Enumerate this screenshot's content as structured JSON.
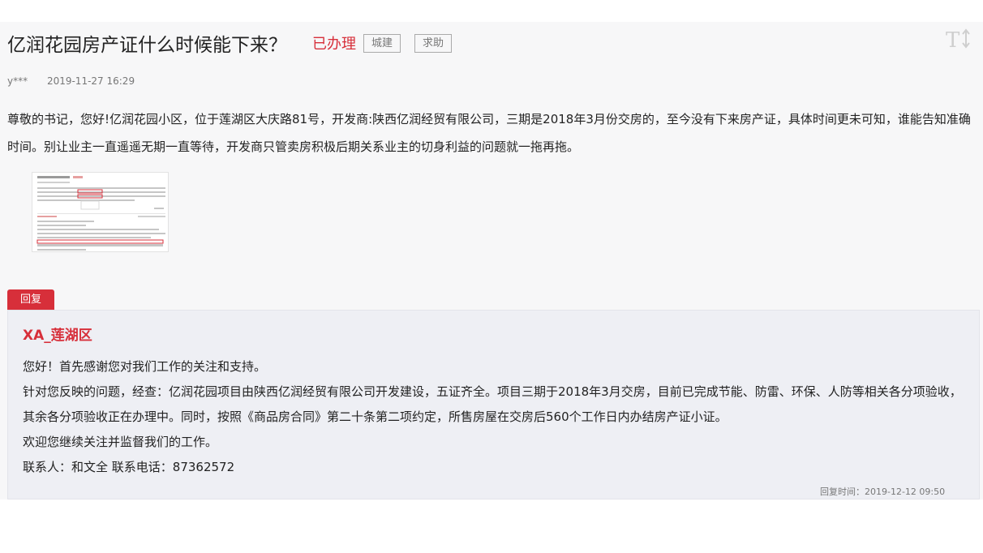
{
  "question": {
    "title": "亿润花园房产证什么时候能下来？",
    "status": "已办理",
    "tags": [
      "城建",
      "求助"
    ],
    "author": "y***",
    "time": "2019-11-27 16:29",
    "content": "尊敬的书记，您好!亿润花园小区，位于莲湖区大庆路81号，开发商:陕西亿润经贸有限公司，三期是2018年3月份交房的，至今没有下来房产证，具体时间更未可知，谁能告知准确时间。别让业主一直遥遥无期一直等待，开发商只管卖房积极后期关系业主的切身利益的问题就一拖再拖。"
  },
  "icons": {
    "font_size": "font-size-toggle-icon"
  },
  "reply": {
    "tab_label": "回复",
    "department": "XA_莲湖区",
    "lines": [
      "您好！首先感谢您对我们工作的关注和支持。",
      " 针对您反映的问题，经查：亿润花园项目由陕西亿润经贸有限公司开发建设，五证齐全。项目三期于2018年3月交房，目前已完成节能、防雷、环保、人防等相关各分项验收，其余各分项验收正在办理中。同时，按照《商品房合同》第二十条第二项约定，所售房屋在交房后560个工作日内办结房产证小证。",
      " 欢迎您继续关注并监督我们的工作。",
      " 联系人：和文全 联系电话：87362572"
    ],
    "time": "回复时间：2019-12-12 09:50"
  },
  "colors": {
    "accent": "#d72f3a",
    "reply_bg": "#eeeff4",
    "page_bg": "#f7f7f8"
  }
}
